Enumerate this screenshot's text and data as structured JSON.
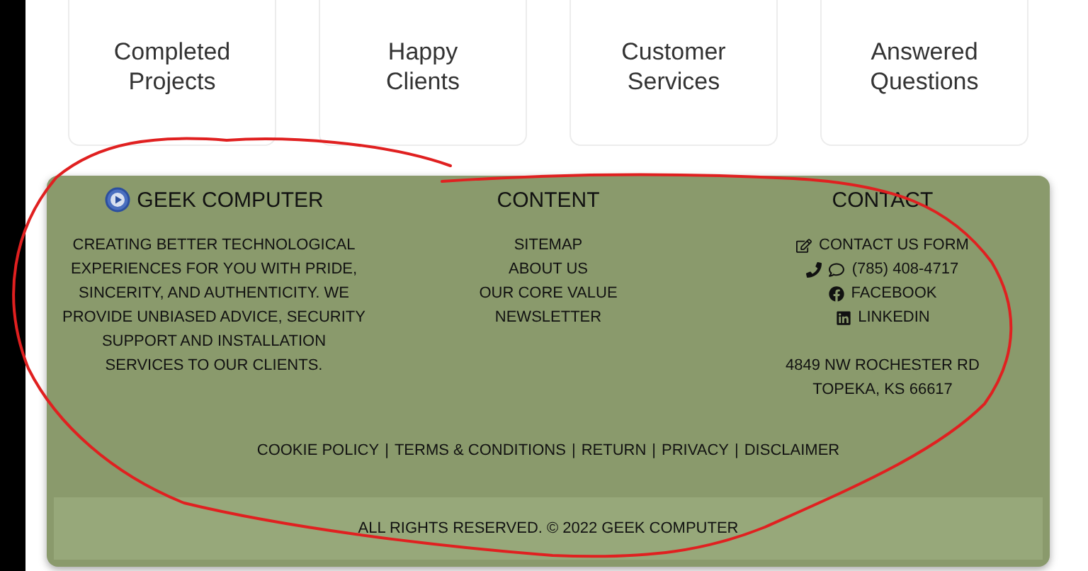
{
  "stat_cards": [
    {
      "label": "Completed Projects"
    },
    {
      "label": "Happy Clients"
    },
    {
      "label": "Customer Services"
    },
    {
      "label": "Answered Questions"
    }
  ],
  "footer": {
    "brand": {
      "name": "GEEK COMPUTER",
      "description": "CREATING BETTER TECHNOLOGICAL EXPERIENCES FOR YOU WITH PRIDE, SINCERITY, AND AUTHENTICITY. WE PROVIDE UNBIASED ADVICE, SECURITY SUPPORT AND INSTALLATION SERVICES TO OUR CLIENTS."
    },
    "content": {
      "heading": "CONTENT",
      "links": [
        "SITEMAP",
        "ABOUT US",
        "OUR CORE VALUE",
        "NEWSLETTER"
      ]
    },
    "contact": {
      "heading": "CONTACT",
      "items": [
        {
          "kind": "form",
          "label": "CONTACT US FORM"
        },
        {
          "kind": "phone",
          "label": "(785) 408-4717"
        },
        {
          "kind": "facebook",
          "label": "FACEBOOK"
        },
        {
          "kind": "linkedin",
          "label": "LINKEDIN"
        }
      ],
      "address": [
        "4849 NW ROCHESTER RD",
        "TOPEKA, KS 66617"
      ]
    },
    "legal_links": [
      "COOKIE POLICY",
      "TERMS & CONDITIONS",
      "RETURN",
      "PRIVACY",
      "DISCLAIMER"
    ],
    "legal_separator": "|",
    "copyright": "ALL RIGHTS RESERVED. © 2022 GEEK COMPUTER"
  }
}
